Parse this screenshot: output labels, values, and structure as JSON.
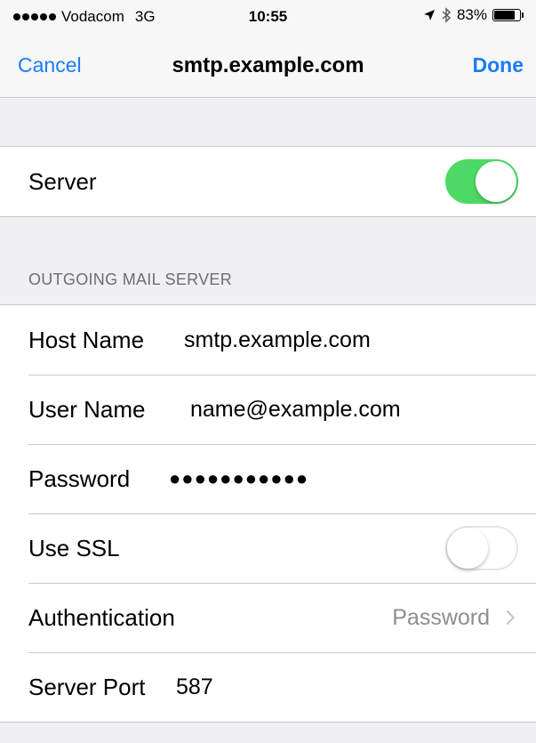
{
  "status_bar": {
    "carrier": "Vodacom",
    "network": "3G",
    "time": "10:55",
    "battery": "83%",
    "battery_level": 0.83,
    "icons": [
      "signal-dots-icon",
      "location-arrow-icon",
      "bluetooth-icon",
      "battery-icon"
    ]
  },
  "nav": {
    "cancel": "Cancel",
    "title": "smtp.example.com",
    "done": "Done"
  },
  "server_toggle": {
    "label": "Server",
    "on": true
  },
  "section_outgoing": {
    "header": "OUTGOING MAIL SERVER"
  },
  "fields": {
    "host_name": {
      "label": "Host Name",
      "value": "smtp.example.com"
    },
    "user_name": {
      "label": "User Name",
      "value": "name@example.com"
    },
    "password": {
      "label": "Password",
      "value": "●●●●●●●●●●●"
    },
    "use_ssl": {
      "label": "Use SSL",
      "on": false
    },
    "authentication": {
      "label": "Authentication",
      "value": "Password"
    },
    "server_port": {
      "label": "Server Port",
      "value": "587"
    }
  },
  "colors": {
    "tint": "#1a7cf5",
    "toggle_on": "#4cd964",
    "background": "#efeff4"
  }
}
